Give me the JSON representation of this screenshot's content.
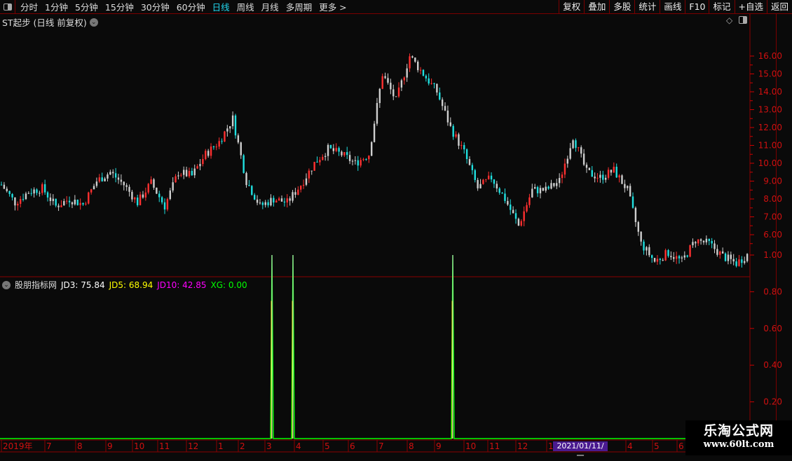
{
  "toolbar": {
    "periods": [
      "分时",
      "1分钟",
      "5分钟",
      "15分钟",
      "30分钟",
      "60分钟",
      "日线",
      "周线",
      "月线",
      "多周期",
      "更多 >"
    ],
    "active": "日线",
    "right_buttons": [
      "复权",
      "叠加",
      "多股",
      "统计",
      "画线",
      "F10",
      "标记",
      "+自选",
      "返回"
    ]
  },
  "main": {
    "title": "ST起步 (日线 前复权)",
    "y_ticks": [
      "16.00",
      "15.00",
      "14.00",
      "13.00",
      "12.00",
      "11.00",
      "10.00",
      "9.00",
      "8.00",
      "7.00",
      "6.00"
    ]
  },
  "indicator": {
    "name": "股朋指标网",
    "jd3": "JD3: 75.84",
    "jd5": "JD5: 68.94",
    "jd10": "JD10: 42.85",
    "xg": "XG: 0.00",
    "y_ticks": [
      "1.00",
      "0.80",
      "0.60",
      "0.40",
      "0.20"
    ],
    "colors": {
      "jd3": "#ffffff",
      "jd5": "#ffff00",
      "jd10": "#ff00ff",
      "xg": "#00ff00"
    }
  },
  "time_axis": {
    "labels": [
      "2019年",
      "7",
      "8",
      "9",
      "10",
      "11",
      "12",
      "1",
      "2",
      "3",
      "4",
      "5",
      "6",
      "7",
      "8",
      "9",
      "10",
      "11",
      "12",
      "1",
      "4",
      "5",
      "6"
    ],
    "cursor_date": "2021/01/11/一"
  },
  "watermark": {
    "name": "乐淘公式网",
    "url": "www.60lt.com"
  },
  "chart_data": {
    "type": "candlestick",
    "ylim": [
      4,
      17
    ],
    "approx_close": [
      8.8,
      7.8,
      8.4,
      8.6,
      7.6,
      8.0,
      7.7,
      9.0,
      9.5,
      8.8,
      7.8,
      8.9,
      7.6,
      9.5,
      9.3,
      10.5,
      11.2,
      12.5,
      9.0,
      7.6,
      8.0,
      7.8,
      8.8,
      10.0,
      10.8,
      10.5,
      10.0,
      10.5,
      15.0,
      13.5,
      16.0,
      15.0,
      14.0,
      12.0,
      10.6,
      8.6,
      9.2,
      8.0,
      6.5,
      8.5,
      8.5,
      9.0,
      11.5,
      9.5,
      9.2,
      9.6,
      8.5,
      5.5,
      4.5,
      5.0,
      4.5,
      5.7,
      5.5,
      4.8,
      4.4,
      5.0
    ],
    "indicator_spikes": [
      {
        "month": "2019-03",
        "value": 1.0
      },
      {
        "month": "2019-04",
        "value": 1.0
      },
      {
        "month": "2020-09",
        "value": 1.0
      }
    ]
  }
}
